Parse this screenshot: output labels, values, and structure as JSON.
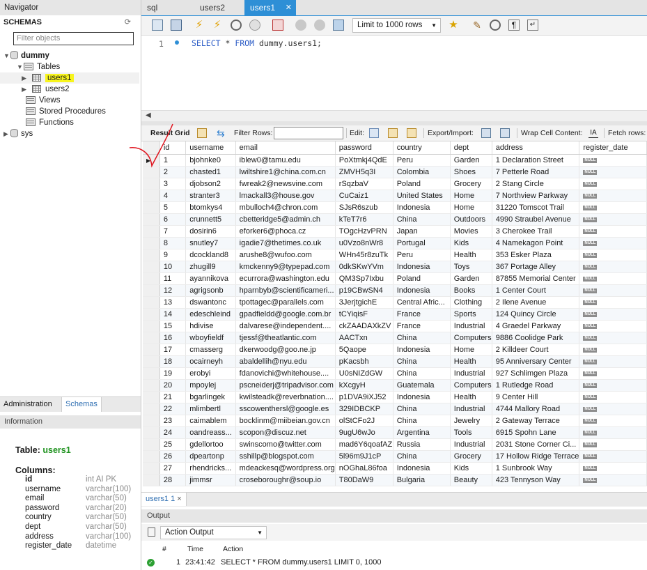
{
  "navigator": {
    "title": "Navigator",
    "schemas_label": "SCHEMAS",
    "filter_placeholder": "Filter objects",
    "tree": {
      "db_dummy": "dummy",
      "tables": "Tables",
      "table1": "users1",
      "table2": "users2",
      "views": "Views",
      "procs": "Stored Procedures",
      "functions": "Functions",
      "db_sys": "sys"
    },
    "tabs": {
      "administration": "Administration",
      "schemas": "Schemas"
    }
  },
  "information": {
    "title": "Information",
    "table_label": "Table:",
    "table_name": "users1",
    "columns_label": "Columns:",
    "columns": [
      {
        "name": "id",
        "type": "int AI PK"
      },
      {
        "name": "username",
        "type": "varchar(100)"
      },
      {
        "name": "email",
        "type": "varchar(50)"
      },
      {
        "name": "password",
        "type": "varchar(20)"
      },
      {
        "name": "country",
        "type": "varchar(50)"
      },
      {
        "name": "dept",
        "type": "varchar(50)"
      },
      {
        "name": "address",
        "type": "varchar(100)"
      },
      {
        "name": "register_date",
        "type": "datetime"
      }
    ]
  },
  "query_tabs": [
    "sql",
    "users2",
    "users1"
  ],
  "toolbar": {
    "limit_label": "Limit to 1000 rows"
  },
  "editor": {
    "line_number": "1",
    "kw_select": "SELECT",
    "star": " * ",
    "kw_from": "FROM",
    "rest": " dummy.users1;"
  },
  "result_toolbar": {
    "result_grid": "Result Grid",
    "filter_rows": "Filter Rows:",
    "edit": "Edit:",
    "export_import": "Export/Import:",
    "wrap": "Wrap Cell Content:",
    "fetch": "Fetch rows:"
  },
  "grid": {
    "columns": [
      "id",
      "username",
      "email",
      "password",
      "country",
      "dept",
      "address",
      "register_date"
    ],
    "null_label": "NULL",
    "rows": [
      [
        "1",
        "bjohnke0",
        "iblew0@tamu.edu",
        "PoXtmkj4QdE",
        "Peru",
        "Garden",
        "1 Declaration Street"
      ],
      [
        "2",
        "chasted1",
        "lwiltshire1@china.com.cn",
        "ZMVH5q3I",
        "Colombia",
        "Shoes",
        "7 Petterle Road"
      ],
      [
        "3",
        "djobson2",
        "fwreak2@newsvine.com",
        "rSqzbaV",
        "Poland",
        "Grocery",
        "2 Stang Circle"
      ],
      [
        "4",
        "stranter3",
        "lmackall3@house.gov",
        "CuCaiz1",
        "United States",
        "Home",
        "7 Northview Parkway"
      ],
      [
        "5",
        "btomkys4",
        "mbulloch4@chron.com",
        "SJsR6szub",
        "Indonesia",
        "Home",
        "31220 Tomscot Trail"
      ],
      [
        "6",
        "crunnett5",
        "cbetteridge5@admin.ch",
        "kTeT7r6",
        "China",
        "Outdoors",
        "4990 Straubel Avenue"
      ],
      [
        "7",
        "dosirin6",
        "eforker6@phoca.cz",
        "TOgcHzvPRN",
        "Japan",
        "Movies",
        "3 Cherokee Trail"
      ],
      [
        "8",
        "snutley7",
        "igadie7@thetimes.co.uk",
        "u0Vzo8nWr8",
        "Portugal",
        "Kids",
        "4 Namekagon Point"
      ],
      [
        "9",
        "dcockland8",
        "arushe8@wufoo.com",
        "WHn45r8zuTk",
        "Peru",
        "Health",
        "353 Esker Plaza"
      ],
      [
        "10",
        "zhugill9",
        "kmckenny9@typepad.com",
        "0dkSKwYVm",
        "Indonesia",
        "Toys",
        "367 Portage Alley"
      ],
      [
        "11",
        "ayannikova",
        "ecurrora@washington.edu",
        "QM3Sp7Ixbu",
        "Poland",
        "Garden",
        "87855 Memorial Center"
      ],
      [
        "12",
        "agrigsonb",
        "hparnbyb@scientificameri...",
        "p19CBwSN4",
        "Indonesia",
        "Books",
        "1 Center Court"
      ],
      [
        "13",
        "dswantonc",
        "tpottagec@parallels.com",
        "3JerjtgichE",
        "Central Afric...",
        "Clothing",
        "2 Ilene Avenue"
      ],
      [
        "14",
        "edeschleind",
        "gpadfieldd@google.com.br",
        "tCYiqisF",
        "France",
        "Sports",
        "124 Quincy Circle"
      ],
      [
        "15",
        "hdivise",
        "dalvarese@independent....",
        "ckZAADAXkZV",
        "France",
        "Industrial",
        "4 Graedel Parkway"
      ],
      [
        "16",
        "wboyfieldf",
        "tjessf@theatlantic.com",
        "AACTxn",
        "China",
        "Computers",
        "9886 Coolidge Park"
      ],
      [
        "17",
        "cmasserg",
        "dkerwoodg@goo.ne.jp",
        "5Qaope",
        "Indonesia",
        "Home",
        "2 Killdeer Court"
      ],
      [
        "18",
        "ocairneyh",
        "abaldellih@nyu.edu",
        "pKacsbh",
        "China",
        "Health",
        "95 Anniversary Center"
      ],
      [
        "19",
        "erobyi",
        "fdanovichi@whitehouse....",
        "U0sNIZdGW",
        "China",
        "Industrial",
        "927 Schlimgen Plaza"
      ],
      [
        "20",
        "mpoylej",
        "pscneiderj@tripadvisor.com",
        "kXcgyH",
        "Guatemala",
        "Computers",
        "1 Rutledge Road"
      ],
      [
        "21",
        "bgarlingek",
        "kwilsteadk@reverbnation....",
        "p1DVA9iXJ52",
        "Indonesia",
        "Health",
        "9 Center Hill"
      ],
      [
        "22",
        "mlimbertl",
        "sscowenthersl@google.es",
        "329IDBCKP",
        "China",
        "Industrial",
        "4744 Mallory Road"
      ],
      [
        "23",
        "caimablem",
        "bocklinm@miibeian.gov.cn",
        "olStCFo2J",
        "China",
        "Jewelry",
        "2 Gateway Terrace"
      ],
      [
        "24",
        "oandreass...",
        "scopon@discuz.net",
        "9ugU6wJo",
        "Argentina",
        "Tools",
        "6915 Spohn Lane"
      ],
      [
        "25",
        "gdellortoo",
        "swinscomo@twitter.com",
        "mad6Y6qoafAZ",
        "Russia",
        "Industrial",
        "2031 Stone Corner Ci..."
      ],
      [
        "26",
        "dpeartonp",
        "sshillp@blogspot.com",
        "5l96m9J1cP",
        "China",
        "Grocery",
        "17 Hollow Ridge Terrace"
      ],
      [
        "27",
        "rhendricks...",
        "mdeackesq@wordpress.org",
        "nOGhaL86foa",
        "Indonesia",
        "Kids",
        "1 Sunbrook Way"
      ],
      [
        "28",
        "jimmsr",
        "croseboroughr@soup.io",
        "T80DaW9",
        "Bulgaria",
        "Beauty",
        "423 Tennyson Way"
      ]
    ]
  },
  "result_tab": {
    "label": "users1 1",
    "close": "×"
  },
  "output": {
    "title": "Output",
    "selector": "Action Output",
    "headers": {
      "num": "#",
      "time": "Time",
      "action": "Action"
    },
    "row": {
      "num": "1",
      "time": "23:41:42",
      "action": "SELECT * FROM dummy.users1 LIMIT 0, 1000"
    }
  }
}
